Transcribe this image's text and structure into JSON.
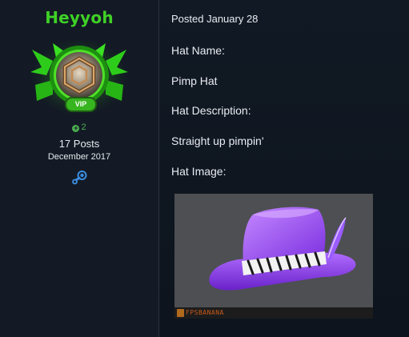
{
  "author": {
    "name": "Heyyoh",
    "badge": "VIP",
    "reputation": "2",
    "posts": "17 Posts",
    "joined": "December 2017"
  },
  "post": {
    "posted": "Posted January 28",
    "lines": [
      "Hat Name:",
      "Pimp Hat",
      "Hat Description:",
      "Straight up pimpin'",
      "Hat Image:"
    ],
    "image_watermark": "FPSBANANA"
  },
  "colors": {
    "username": "#3fd126",
    "background": "#0f1621",
    "hat": "#8a3fe0"
  },
  "icons": [
    "plus-icon",
    "steam-icon",
    "rank-emblem-icon"
  ]
}
